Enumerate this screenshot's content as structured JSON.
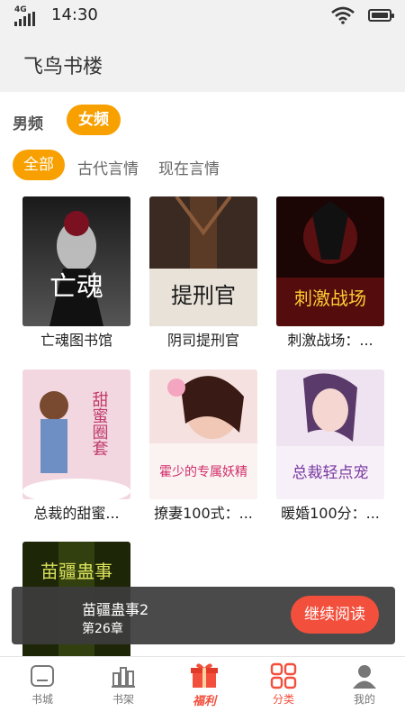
{
  "status_bar": {
    "network": "4G",
    "time": "14:30"
  },
  "app": {
    "title": "飞鸟书楼"
  },
  "channel_tabs": [
    {
      "label": "男频",
      "active": false
    },
    {
      "label": "女频",
      "active": true
    }
  ],
  "category_tabs": [
    {
      "label": "全部",
      "active": true
    },
    {
      "label": "古代言情",
      "active": false
    },
    {
      "label": "现在言情",
      "active": false
    }
  ],
  "books": [
    {
      "title": "亡魂图书馆",
      "cover_text": "亡魂",
      "cover_color": "#2b2b2b"
    },
    {
      "title": "阴司提刑官",
      "cover_text": "提刑官",
      "cover_color": "#3a2a22"
    },
    {
      "title": "刺激战场：...",
      "cover_text": "刺激战场",
      "cover_color": "#4a1010"
    },
    {
      "title": "总裁的甜蜜...",
      "cover_text": "甜蜜圈套",
      "cover_color": "#f3d7e0"
    },
    {
      "title": "撩妻100式：...",
      "cover_text": "霍少的专属妖精",
      "cover_color": "#f6e1e1"
    },
    {
      "title": "暖婚100分：...",
      "cover_text": "总裁轻点宠",
      "cover_color": "#efe2f1"
    },
    {
      "title": "",
      "cover_text": "苗疆蛊事",
      "cover_color": "#2d3a10"
    }
  ],
  "continue_reading": {
    "title": "苗疆蛊事2",
    "chapter": "第26章",
    "button_label": "继续阅读"
  },
  "bottom_nav": [
    {
      "label": "书城",
      "icon": "home-icon",
      "active": false
    },
    {
      "label": "书架",
      "icon": "bookshelf-icon",
      "active": false
    },
    {
      "label": "福利",
      "icon": "gift-icon",
      "active": true
    },
    {
      "label": "分类",
      "icon": "category-icon",
      "active": true
    },
    {
      "label": "我的",
      "icon": "profile-icon",
      "active": false
    }
  ],
  "colors": {
    "accent": "#f7a000",
    "primary_red": "#f24f3c",
    "header_bg": "#f1f1f1"
  }
}
